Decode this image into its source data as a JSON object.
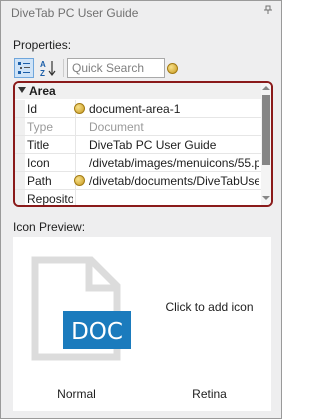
{
  "window": {
    "title": "DiveTab PC User Guide"
  },
  "properties": {
    "label": "Properties:",
    "search_placeholder": "Quick Search",
    "category": "Area",
    "rows": [
      {
        "name": "Id",
        "value": "document-area-1",
        "disabled": false,
        "has_icon": true
      },
      {
        "name": "Type",
        "value": "Document",
        "disabled": true,
        "has_icon": false
      },
      {
        "name": "Title",
        "value": "DiveTab PC User Guide",
        "disabled": false,
        "has_icon": false
      },
      {
        "name": "Icon",
        "value": "/divetab/images/menuicons/55.p",
        "disabled": false,
        "has_icon": false
      },
      {
        "name": "Path",
        "value": "/divetab/documents/DiveTabUser",
        "disabled": false,
        "has_icon": true
      },
      {
        "name": "Repository",
        "value": "",
        "disabled": false,
        "has_icon": false
      }
    ]
  },
  "icon_preview": {
    "label": "Icon Preview:",
    "normal_caption": "Normal",
    "retina_caption": "Retina",
    "retina_placeholder": "Click to add icon",
    "doc_badge": "DOC"
  },
  "colors": {
    "accent": "#1b7bbd",
    "doc_badge": "#1b7bbd",
    "grid_border": "#8a1a1a"
  }
}
